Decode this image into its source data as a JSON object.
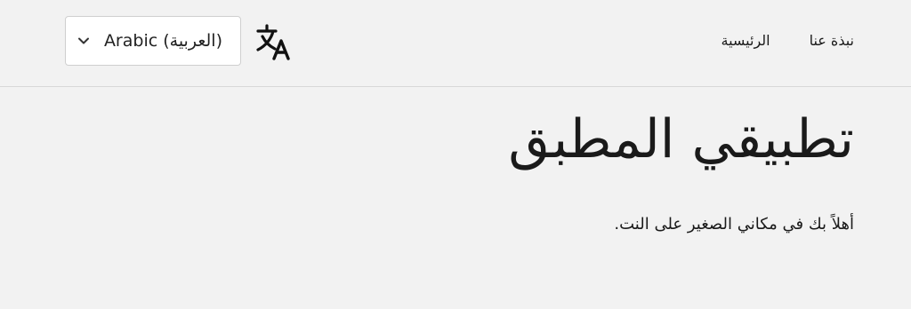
{
  "header": {
    "language_select": {
      "selected": "Arabic (العربية)"
    },
    "translate_icon": "translate-icon",
    "nav": [
      {
        "label": "الرئيسية"
      },
      {
        "label": "نبذة عنا"
      }
    ]
  },
  "main": {
    "title": "تطبيقي المطبق",
    "lead": "أهلاً بك في مكاني الصغير على النت."
  }
}
